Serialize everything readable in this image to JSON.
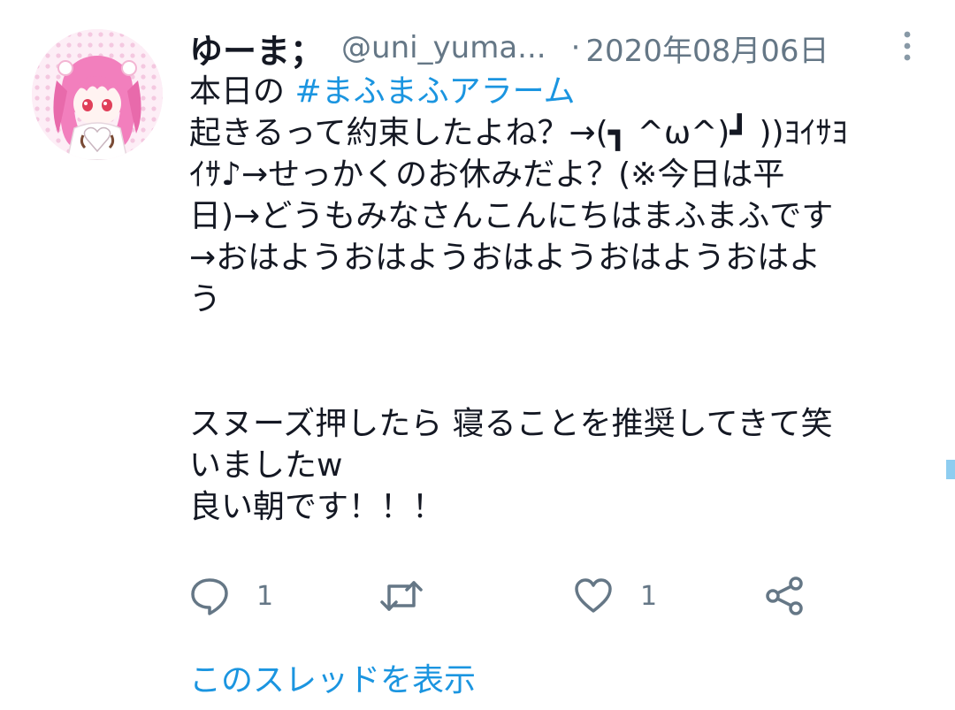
{
  "tweet": {
    "display_name": "ゆーま；",
    "handle": "@uni_yuma...",
    "separator": "·",
    "date": "2020年08月06日",
    "lines": [
      {
        "prefix": "本日の ",
        "hashtag": "#まふまふアラーム"
      },
      {
        "text": "起きるって約束したよね？→(┓ ^ω^)┛ ))ﾖｲｻﾖ"
      },
      {
        "text": "ｲｻ♪→せっかくのお休みだよ？(※今日は平"
      },
      {
        "text": "日)→どうもみなさんこんにちはまふまふです"
      },
      {
        "text": "→おはようおはようおはようおはようおはよ"
      },
      {
        "text": "う"
      },
      {
        "text": ""
      },
      {
        "text": ""
      },
      {
        "text": "スヌーズ押したら 寝ることを推奨してきて笑"
      },
      {
        "text": "いましたw"
      },
      {
        "text": "良い朝です！！！"
      }
    ],
    "reply_count": "1",
    "retweet_count": "",
    "like_count": "1",
    "thread_link": "このスレッドを表示"
  },
  "icons": {
    "reply": "reply-icon",
    "retweet": "retweet-icon",
    "like": "like-icon",
    "share": "share-icon",
    "more": "more-vertical-icon"
  },
  "colors": {
    "text": "#141823",
    "secondary": "#657786",
    "link": "#1b95e0"
  }
}
